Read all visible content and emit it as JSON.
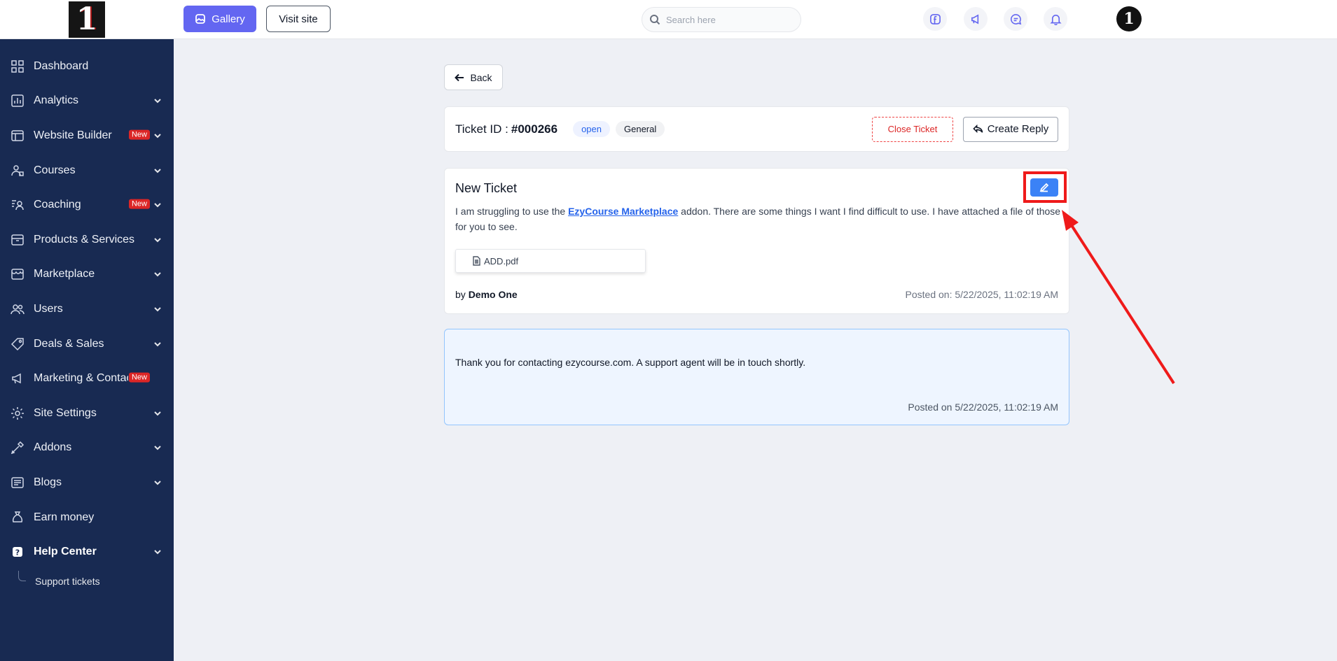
{
  "sidebar": {
    "items": [
      {
        "label": "Dashboard",
        "icon": "dashboard-icon",
        "chevron": false,
        "badge": ""
      },
      {
        "label": "Analytics",
        "icon": "analytics-icon",
        "chevron": true,
        "badge": ""
      },
      {
        "label": "Website Builder",
        "icon": "website-builder-icon",
        "chevron": true,
        "badge": "New"
      },
      {
        "label": "Courses",
        "icon": "courses-icon",
        "chevron": true,
        "badge": ""
      },
      {
        "label": "Coaching",
        "icon": "coaching-icon",
        "chevron": true,
        "badge": "New"
      },
      {
        "label": "Products & Services",
        "icon": "products-icon",
        "chevron": true,
        "badge": ""
      },
      {
        "label": "Marketplace",
        "icon": "marketplace-icon",
        "chevron": true,
        "badge": ""
      },
      {
        "label": "Users",
        "icon": "users-icon",
        "chevron": true,
        "badge": ""
      },
      {
        "label": "Deals & Sales",
        "icon": "tag-icon",
        "chevron": true,
        "badge": ""
      },
      {
        "label": "Marketing & Contacts",
        "icon": "megaphone-icon",
        "chevron": true,
        "badge": "New"
      },
      {
        "label": "Site Settings",
        "icon": "gear-icon",
        "chevron": true,
        "badge": ""
      },
      {
        "label": "Addons",
        "icon": "addons-icon",
        "chevron": true,
        "badge": ""
      },
      {
        "label": "Blogs",
        "icon": "blogs-icon",
        "chevron": true,
        "badge": ""
      },
      {
        "label": "Earn money",
        "icon": "money-bag-icon",
        "chevron": false,
        "badge": ""
      },
      {
        "label": "Help Center",
        "icon": "help-icon",
        "chevron": true,
        "badge": "",
        "active": true
      }
    ],
    "sub_items": [
      {
        "label": "Support tickets"
      }
    ]
  },
  "topbar": {
    "gallery_label": "Gallery",
    "visit_label": "Visit site",
    "search_placeholder": "Search here"
  },
  "main": {
    "back_label": "Back",
    "ticket": {
      "id_label": "Ticket ID :",
      "id_value": "#000266",
      "status": "open",
      "category": "General",
      "close_label": "Close Ticket",
      "reply_label": "Create Reply"
    },
    "message": {
      "title": "New Ticket",
      "text_before": "I am struggling to use the ",
      "link_text": "EzyCourse Marketplace",
      "text_after": " addon. There are some things I want I find difficult to use. I have attached a file of those for you to see.",
      "attachment": "ADD.pdf",
      "by_prefix": "by",
      "author": "Demo One",
      "posted": "Posted on: 5/22/2025, 11:02:19 AM"
    },
    "auto_reply": {
      "text": "Thank you for contacting ezycourse.com. A support agent will be in touch shortly.",
      "posted": "Posted on 5/22/2025, 11:02:19 AM"
    }
  },
  "colors": {
    "sidebar_bg": "#182a52",
    "accent": "#6366f1",
    "edit_button": "#3b82f6",
    "annotation": "#ef1a1a"
  }
}
